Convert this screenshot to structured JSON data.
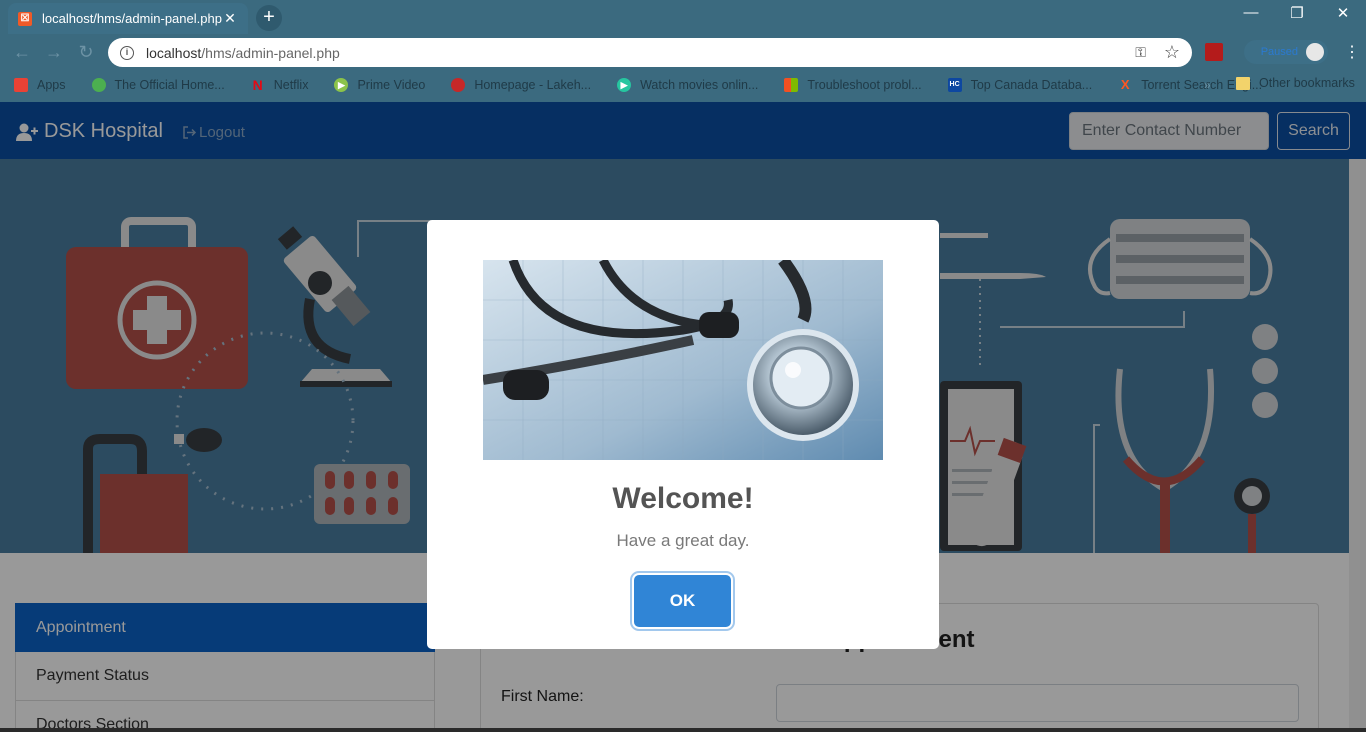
{
  "browser": {
    "tab_title": "localhost/hms/admin-panel.php",
    "url_host": "localhost",
    "url_path": "/hms/admin-panel.php",
    "profile_name": "Paused",
    "bookmarks": [
      {
        "label": "Apps",
        "icon": "apps-grid-icon",
        "color": "#e94235"
      },
      {
        "label": "The Official Home...",
        "icon": "site-icon",
        "color": "#4caf50"
      },
      {
        "label": "Netflix",
        "icon": "netflix-icon",
        "color": "#e50914"
      },
      {
        "label": "Prime Video",
        "icon": "prime-video-icon",
        "color": "#8bc34a"
      },
      {
        "label": "Homepage - Lakeh...",
        "icon": "lakehead-icon",
        "color": "#c62828"
      },
      {
        "label": "Watch movies onlin...",
        "icon": "play-icon",
        "color": "#26c6a0"
      },
      {
        "label": "Troubleshoot probl...",
        "icon": "microsoft-icon",
        "color": "#f25022"
      },
      {
        "label": "Top Canada Databa...",
        "icon": "hc-icon",
        "color": "#0d47a1"
      },
      {
        "label": "Torrent Search Engi...",
        "icon": "torrent-icon",
        "color": "#ff5722"
      }
    ],
    "other_bookmarks": "Other bookmarks",
    "more_chevron": "»"
  },
  "navbar": {
    "brand": "DSK Hospital",
    "logout": "Logout",
    "search_placeholder": "Enter Contact Number",
    "search_button": "Search"
  },
  "sidebar": {
    "items": [
      {
        "label": "Appointment",
        "active": true
      },
      {
        "label": "Payment Status",
        "active": false
      },
      {
        "label": "Doctors Section",
        "active": false
      }
    ]
  },
  "form": {
    "title": "Appointment",
    "first_name_label": "First Name:"
  },
  "modal": {
    "title": "Welcome!",
    "text": "Have a great day.",
    "ok_label": "OK"
  }
}
